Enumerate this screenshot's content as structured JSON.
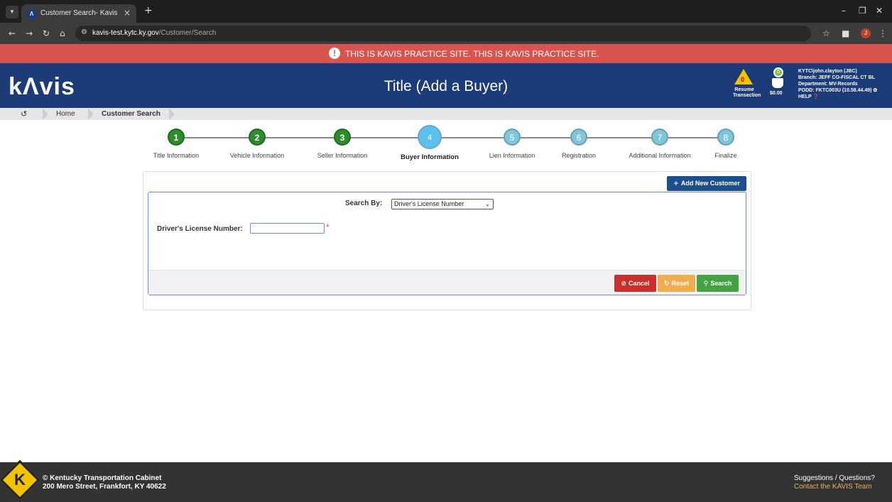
{
  "browser": {
    "tab_title": "Customer Search- Kavis",
    "url_host": "kavis-test.kytc.ky.gov",
    "url_path": "/Customer/Search",
    "profile_initial": "J"
  },
  "banner": {
    "text": "THIS IS KAVIS PRACTICE SITE. THIS IS KAVIS PRACTICE SITE."
  },
  "header": {
    "logo": "kΛvis",
    "title": "Title (Add a Buyer)",
    "resume_count": "0",
    "resume_label": "Resume Transaction",
    "cart_count": "0",
    "cart_amount": "$0.00",
    "user": {
      "line1": "KYTC\\john.clayton (JBC)",
      "line2": "Branch: JEFF CO-FISCAL CT BL",
      "line3": "Department: MV-Records",
      "line4": "PODD: FKTC003U (10.58.44.49) ✿",
      "line5": "HELP ❓"
    }
  },
  "breadcrumb": {
    "items": [
      "Home",
      "Customer Search"
    ]
  },
  "steps": [
    {
      "num": "1",
      "label": "Title Information",
      "state": "done"
    },
    {
      "num": "2",
      "label": "Vehicle Information",
      "state": "done"
    },
    {
      "num": "3",
      "label": "Seller Information",
      "state": "done"
    },
    {
      "num": "4",
      "label": "Buyer Information",
      "state": "active"
    },
    {
      "num": "5",
      "label": "Lien Information",
      "state": "todo"
    },
    {
      "num": "6",
      "label": "Registration",
      "state": "todo"
    },
    {
      "num": "7",
      "label": "Additional Information",
      "state": "todo"
    },
    {
      "num": "8",
      "label": "Finalize",
      "state": "todo"
    }
  ],
  "form": {
    "add_new_label": "Add New Customer",
    "search_by_label": "Search By:",
    "search_by_value": "Driver's License Number",
    "dl_label": "Driver's License Number:",
    "dl_value": "",
    "required_mark": "*",
    "cancel_label": "Cancel",
    "reset_label": "Reset",
    "search_label": "Search"
  },
  "footer": {
    "copyright": "© Kentucky Transportation Cabinet",
    "address": "200 Mero Street, Frankfort, KY 40622",
    "suggestions": "Suggestions / Questions?",
    "contact_link": "Contact the KAVIS Team"
  },
  "colors": {
    "header_blue": "#1b3b79",
    "banner_red": "#d9534f",
    "step_done": "#2e8b2e",
    "step_active": "#5bc0eb",
    "step_todo": "#7fc6d8",
    "cancel": "#c9302c",
    "reset": "#f0ad4e",
    "search": "#44a144"
  }
}
